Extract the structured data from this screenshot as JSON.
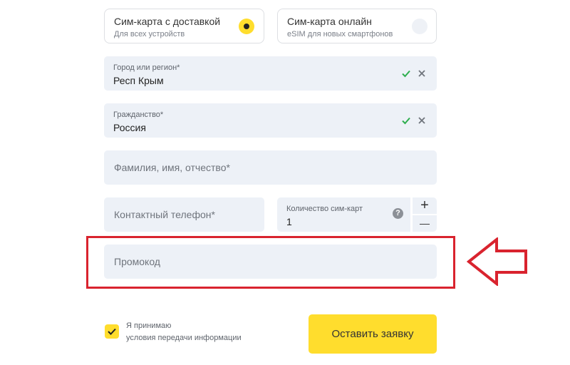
{
  "sim_options": [
    {
      "title": "Сим-карта с доставкой",
      "subtitle": "Для всех устройств",
      "selected": true
    },
    {
      "title": "Сим-карта онлайн",
      "subtitle": "eSIM для новых смартфонов",
      "selected": false
    }
  ],
  "fields": {
    "region": {
      "label": "Город или регион*",
      "value": "Респ Крым"
    },
    "citizenship": {
      "label": "Гражданство*",
      "value": "Россия"
    },
    "full_name": {
      "placeholder": "Фамилия, имя, отчество*"
    },
    "phone": {
      "placeholder": "Контактный телефон*"
    },
    "sim_count": {
      "label": "Количество сим-карт",
      "value": "1",
      "plus": "+",
      "minus": "—"
    },
    "promo": {
      "placeholder": "Промокод"
    }
  },
  "consent": {
    "line1": "Я принимаю",
    "line2": "условия передачи информации",
    "checked": true
  },
  "submit_label": "Оставить заявку",
  "colors": {
    "accent": "#ffdd2d",
    "field_bg": "#edf1f7",
    "highlight": "#d9232e",
    "ok": "#2eae4e"
  },
  "icons": {
    "help": "?"
  }
}
